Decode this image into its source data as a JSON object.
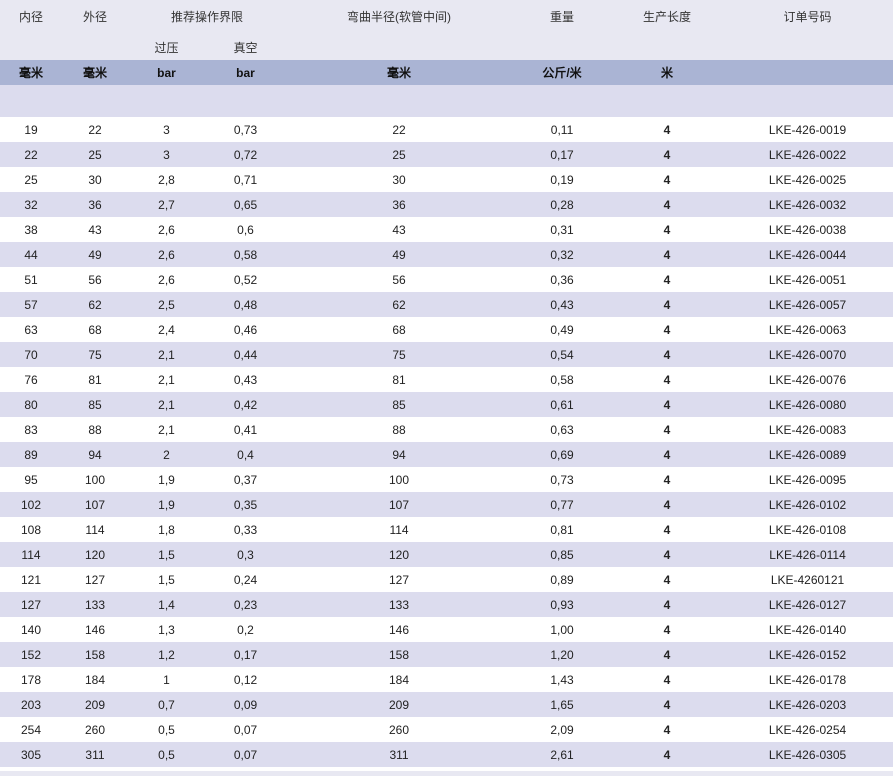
{
  "headers": {
    "inner_diameter": "内径",
    "outer_diameter": "外径",
    "recommended_limit": "推荐操作界限",
    "bend_radius": "弯曲半径(软管中间)",
    "weight": "重量",
    "production_length": "生产长度",
    "order_number": "订单号码",
    "overpressure": "过压",
    "vacuum": "真空"
  },
  "units": {
    "inner_diameter": "毫米",
    "outer_diameter": "毫米",
    "overpressure": "bar",
    "vacuum": "bar",
    "bend_radius": "毫米",
    "weight": "公斤/米",
    "production_length": "米",
    "order_number": ""
  },
  "rows": [
    {
      "id": "19",
      "od": "22",
      "op": "3",
      "vac": "0,73",
      "br": "22",
      "w": "0,11",
      "len": "4",
      "order": "LKE-426-0019"
    },
    {
      "id": "22",
      "od": "25",
      "op": "3",
      "vac": "0,72",
      "br": "25",
      "w": "0,17",
      "len": "4",
      "order": "LKE-426-0022"
    },
    {
      "id": "25",
      "od": "30",
      "op": "2,8",
      "vac": "0,71",
      "br": "30",
      "w": "0,19",
      "len": "4",
      "order": "LKE-426-0025"
    },
    {
      "id": "32",
      "od": "36",
      "op": "2,7",
      "vac": "0,65",
      "br": "36",
      "w": "0,28",
      "len": "4",
      "order": "LKE-426-0032"
    },
    {
      "id": "38",
      "od": "43",
      "op": "2,6",
      "vac": "0,6",
      "br": "43",
      "w": "0,31",
      "len": "4",
      "order": "LKE-426-0038"
    },
    {
      "id": "44",
      "od": "49",
      "op": "2,6",
      "vac": "0,58",
      "br": "49",
      "w": "0,32",
      "len": "4",
      "order": "LKE-426-0044"
    },
    {
      "id": "51",
      "od": "56",
      "op": "2,6",
      "vac": "0,52",
      "br": "56",
      "w": "0,36",
      "len": "4",
      "order": "LKE-426-0051"
    },
    {
      "id": "57",
      "od": "62",
      "op": "2,5",
      "vac": "0,48",
      "br": "62",
      "w": "0,43",
      "len": "4",
      "order": "LKE-426-0057"
    },
    {
      "id": "63",
      "od": "68",
      "op": "2,4",
      "vac": "0,46",
      "br": "68",
      "w": "0,49",
      "len": "4",
      "order": "LKE-426-0063"
    },
    {
      "id": "70",
      "od": "75",
      "op": "2,1",
      "vac": "0,44",
      "br": "75",
      "w": "0,54",
      "len": "4",
      "order": "LKE-426-0070"
    },
    {
      "id": "76",
      "od": "81",
      "op": "2,1",
      "vac": "0,43",
      "br": "81",
      "w": "0,58",
      "len": "4",
      "order": "LKE-426-0076"
    },
    {
      "id": "80",
      "od": "85",
      "op": "2,1",
      "vac": "0,42",
      "br": "85",
      "w": "0,61",
      "len": "4",
      "order": "LKE-426-0080"
    },
    {
      "id": "83",
      "od": "88",
      "op": "2,1",
      "vac": "0,41",
      "br": "88",
      "w": "0,63",
      "len": "4",
      "order": "LKE-426-0083"
    },
    {
      "id": "89",
      "od": "94",
      "op": "2",
      "vac": "0,4",
      "br": "94",
      "w": "0,69",
      "len": "4",
      "order": "LKE-426-0089"
    },
    {
      "id": "95",
      "od": "100",
      "op": "1,9",
      "vac": "0,37",
      "br": "100",
      "w": "0,73",
      "len": "4",
      "order": "LKE-426-0095"
    },
    {
      "id": "102",
      "od": "107",
      "op": "1,9",
      "vac": "0,35",
      "br": "107",
      "w": "0,77",
      "len": "4",
      "order": "LKE-426-0102"
    },
    {
      "id": "108",
      "od": "114",
      "op": "1,8",
      "vac": "0,33",
      "br": "114",
      "w": "0,81",
      "len": "4",
      "order": "LKE-426-0108"
    },
    {
      "id": "114",
      "od": "120",
      "op": "1,5",
      "vac": "0,3",
      "br": "120",
      "w": "0,85",
      "len": "4",
      "order": "LKE-426-0114"
    },
    {
      "id": "121",
      "od": "127",
      "op": "1,5",
      "vac": "0,24",
      "br": "127",
      "w": "0,89",
      "len": "4",
      "order": "LKE-4260121"
    },
    {
      "id": "127",
      "od": "133",
      "op": "1,4",
      "vac": "0,23",
      "br": "133",
      "w": "0,93",
      "len": "4",
      "order": "LKE-426-0127"
    },
    {
      "id": "140",
      "od": "146",
      "op": "1,3",
      "vac": "0,2",
      "br": "146",
      "w": "1,00",
      "len": "4",
      "order": "LKE-426-0140"
    },
    {
      "id": "152",
      "od": "158",
      "op": "1,2",
      "vac": "0,17",
      "br": "158",
      "w": "1,20",
      "len": "4",
      "order": "LKE-426-0152"
    },
    {
      "id": "178",
      "od": "184",
      "op": "1",
      "vac": "0,12",
      "br": "184",
      "w": "1,43",
      "len": "4",
      "order": "LKE-426-0178"
    },
    {
      "id": "203",
      "od": "209",
      "op": "0,7",
      "vac": "0,09",
      "br": "209",
      "w": "1,65",
      "len": "4",
      "order": "LKE-426-0203"
    },
    {
      "id": "254",
      "od": "260",
      "op": "0,5",
      "vac": "0,07",
      "br": "260",
      "w": "2,09",
      "len": "4",
      "order": "LKE-426-0254"
    },
    {
      "id": "305",
      "od": "311",
      "op": "0,5",
      "vac": "0,07",
      "br": "311",
      "w": "2,61",
      "len": "4",
      "order": "LKE-426-0305"
    }
  ]
}
